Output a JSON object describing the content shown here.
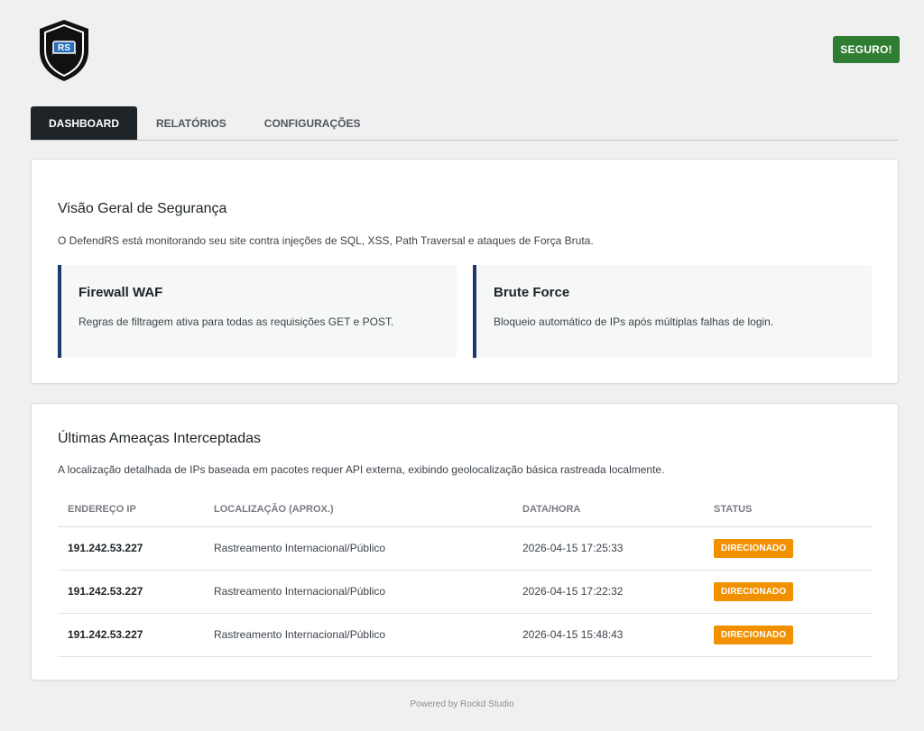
{
  "header": {
    "logo_text": "RS",
    "status_label": "SEGURO!"
  },
  "tabs": [
    {
      "label": "DASHBOARD",
      "active": true
    },
    {
      "label": "RELATÓRIOS",
      "active": false
    },
    {
      "label": "CONFIGURAÇÕES",
      "active": false
    }
  ],
  "overview": {
    "title": "Visão Geral de Segurança",
    "description": "O DefendRS está monitorando seu site contra injeções de SQL, XSS, Path Traversal e ataques de Força Bruta.",
    "features": [
      {
        "title": "Firewall WAF",
        "text": "Regras de filtragem ativa para todas as requisições GET e POST."
      },
      {
        "title": "Brute Force",
        "text": "Bloqueio automático de IPs após múltiplas falhas de login."
      }
    ]
  },
  "threats": {
    "title": "Últimas Ameaças Interceptadas",
    "description": "A localização detalhada de IPs baseada em pacotes requer API externa, exibindo geolocalização básica rastreada localmente.",
    "columns": [
      "ENDEREÇO IP",
      "LOCALIZAÇÃO (APROX.)",
      "DATA/HORA",
      "STATUS"
    ],
    "rows": [
      {
        "ip": "191.242.53.227",
        "location": "Rastreamento Internacional/Público",
        "datetime": "2026-04-15 17:25:33",
        "status": "DIRECIONADO"
      },
      {
        "ip": "191.242.53.227",
        "location": "Rastreamento Internacional/Público",
        "datetime": "2026-04-15 17:22:32",
        "status": "DIRECIONADO"
      },
      {
        "ip": "191.242.53.227",
        "location": "Rastreamento Internacional/Público",
        "datetime": "2026-04-15 15:48:43",
        "status": "DIRECIONADO"
      }
    ]
  },
  "footer": {
    "text": "Powered by Rockd Studio"
  },
  "colors": {
    "status_green": "#2e7d32",
    "tab_active": "#1d2327",
    "feature_accent": "#1e3a6b",
    "badge_orange": "#f29100"
  }
}
